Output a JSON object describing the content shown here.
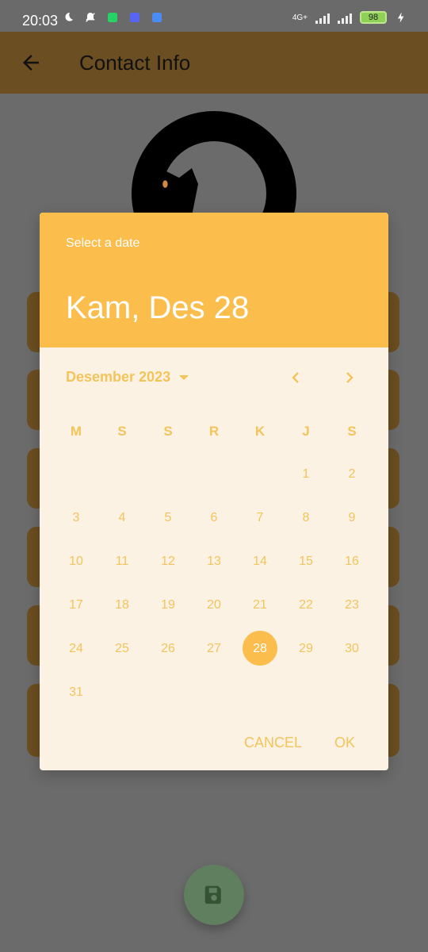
{
  "status_bar": {
    "time": "20:03",
    "network": "4G+",
    "battery": "98"
  },
  "app_bar": {
    "title": "Contact Info"
  },
  "dialog": {
    "header_label": "Select a date",
    "selected_date_text": "Kam, Des 28",
    "month_label": "Desember 2023",
    "weekdays": [
      "M",
      "S",
      "S",
      "R",
      "K",
      "J",
      "S"
    ],
    "days": [
      "1",
      "2",
      "3",
      "4",
      "5",
      "6",
      "7",
      "8",
      "9",
      "10",
      "11",
      "12",
      "13",
      "14",
      "15",
      "16",
      "17",
      "18",
      "19",
      "20",
      "21",
      "22",
      "23",
      "24",
      "25",
      "26",
      "27",
      "28",
      "29",
      "30",
      "31"
    ],
    "selected_day": "28",
    "cancel_label": "CANCEL",
    "ok_label": "OK"
  },
  "colors": {
    "accent": "#FBBD4C",
    "dialog_bg": "#FCF2E3",
    "appbar": "#6B4E21",
    "overlay": "#6B6B6B"
  }
}
